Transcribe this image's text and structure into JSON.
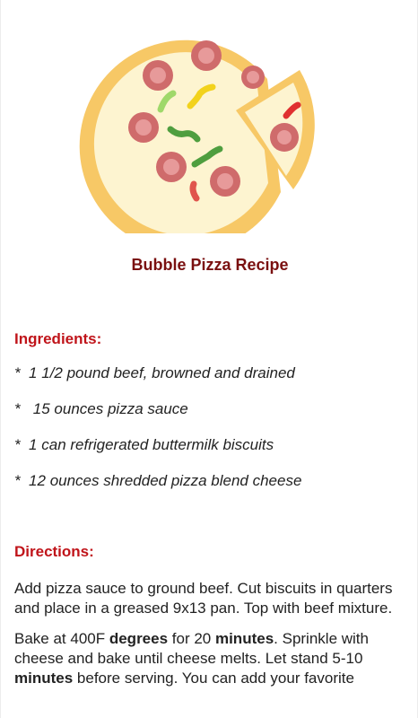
{
  "recipe": {
    "title": "Bubble Pizza Recipe",
    "ingredients_heading": "Ingredients:",
    "ingredients": [
      "*  1 1/2 pound beef, browned and drained",
      "*   15 ounces pizza sauce",
      "*  1 can refrigerated buttermilk biscuits",
      "*  12 ounces shredded pizza blend cheese"
    ],
    "directions_heading": "Directions:",
    "directions_p1": "Add pizza sauce to ground beef. Cut biscuits in quarters and place in a greased 9x13 pan. Top with beef mixture.",
    "directions_p2": {
      "t1": "Bake at 400F ",
      "b1": "degrees",
      "t2": " for 20 ",
      "b2": "minutes",
      "t3": ". Sprinkle with cheese and bake until cheese melts. Let stand 5-10 ",
      "b3": "minutes",
      "t4": " before serving. You can add your favorite"
    }
  },
  "colors": {
    "title": "#7a1010",
    "heading": "#c0141a",
    "crust": "#f7c866",
    "cheese": "#fdf4d0",
    "pepperoni": "#cf6b6b"
  },
  "icons": {
    "hero": "pizza-icon"
  }
}
